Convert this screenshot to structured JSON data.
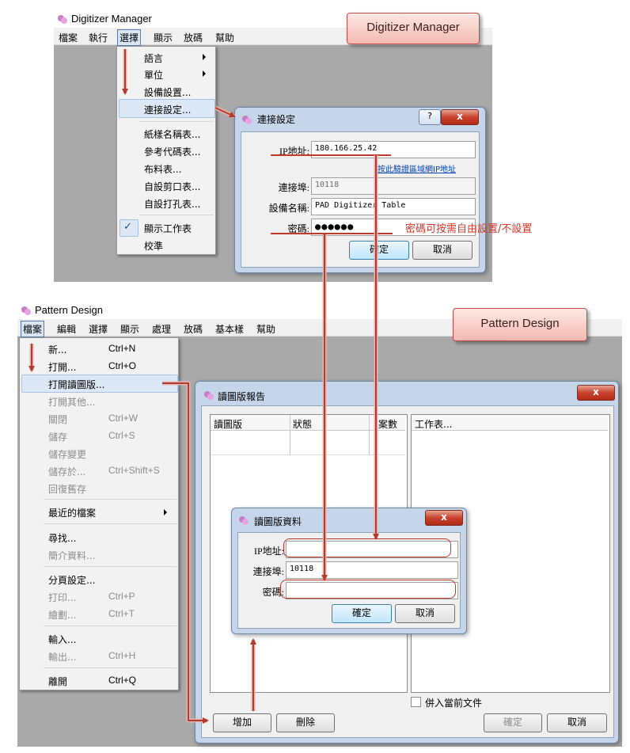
{
  "dm": {
    "title": "Digitizer Manager",
    "menu": [
      "檔案",
      "執行",
      "選擇",
      "顯示",
      "放碼",
      "幫助"
    ],
    "dropdown": [
      "語言",
      "單位",
      "設備設置...",
      "連接設定...",
      "紙樣名稱表...",
      "參考代碼表...",
      "布料表...",
      "自設剪口表...",
      "自設打孔表...",
      "顯示工作表",
      "校準"
    ],
    "check_mark": "✓"
  },
  "conn": {
    "title": "連接設定",
    "help": "?",
    "close": "x",
    "ip_label": "IP地址:",
    "ip_value": "180.166.25.42",
    "link": "按此驗證區域網IP地址",
    "port_label": "連接埠:",
    "port_value": "10118",
    "device_label": "設備名稱:",
    "device_value": "PAD Digitizer Table",
    "pw_label": "密碼:",
    "pw_value": "●●●●●●",
    "ok": "確定",
    "cancel": "取消"
  },
  "note": "密碼可按需自由設置/不設置",
  "callout_dm": "Digitizer Manager",
  "callout_pd": "Pattern Design",
  "pd": {
    "title": "Pattern Design",
    "menu": [
      "檔案",
      "編輯",
      "選擇",
      "顯示",
      "處理",
      "放碼",
      "基本樣",
      "幫助"
    ],
    "file_menu": [
      {
        "label": "新...",
        "shortcut": "Ctrl+N"
      },
      {
        "label": "打開...",
        "shortcut": "Ctrl+O"
      },
      {
        "label": "打開讀圖版...",
        "shortcut": ""
      },
      {
        "label": "打開其他...",
        "shortcut": ""
      },
      {
        "label": "關閉",
        "shortcut": "Ctrl+W"
      },
      {
        "label": "儲存",
        "shortcut": "Ctrl+S"
      },
      {
        "label": "儲存變更",
        "shortcut": ""
      },
      {
        "label": "儲存於...",
        "shortcut": "Ctrl+Shift+S"
      },
      {
        "label": "回復舊存",
        "shortcut": ""
      },
      {
        "label": "最近的檔案",
        "shortcut": ""
      },
      {
        "label": "尋找...",
        "shortcut": ""
      },
      {
        "label": "簡介資料...",
        "shortcut": ""
      },
      {
        "label": "分頁設定...",
        "shortcut": ""
      },
      {
        "label": "打印...",
        "shortcut": "Ctrl+P"
      },
      {
        "label": "繪劃...",
        "shortcut": "Ctrl+T"
      },
      {
        "label": "輸入...",
        "shortcut": ""
      },
      {
        "label": "輸出...",
        "shortcut": "Ctrl+H"
      },
      {
        "label": "離開",
        "shortcut": "Ctrl+Q"
      }
    ]
  },
  "report": {
    "title": "讀圖版報告",
    "close": "x",
    "cols": [
      "讀圖版",
      "狀態",
      "案數"
    ],
    "worksheet": "工作表...",
    "merge": "併入當前文件",
    "add": "增加",
    "delete": "刪除",
    "ok": "確定",
    "cancel": "取消"
  },
  "info": {
    "title": "讀圖版資料",
    "close": "x",
    "ip_label": "IP地址:",
    "port_label": "連接埠:",
    "port_value": "10118",
    "pw_label": "密碼:",
    "ok": "確定",
    "cancel": "取消"
  }
}
